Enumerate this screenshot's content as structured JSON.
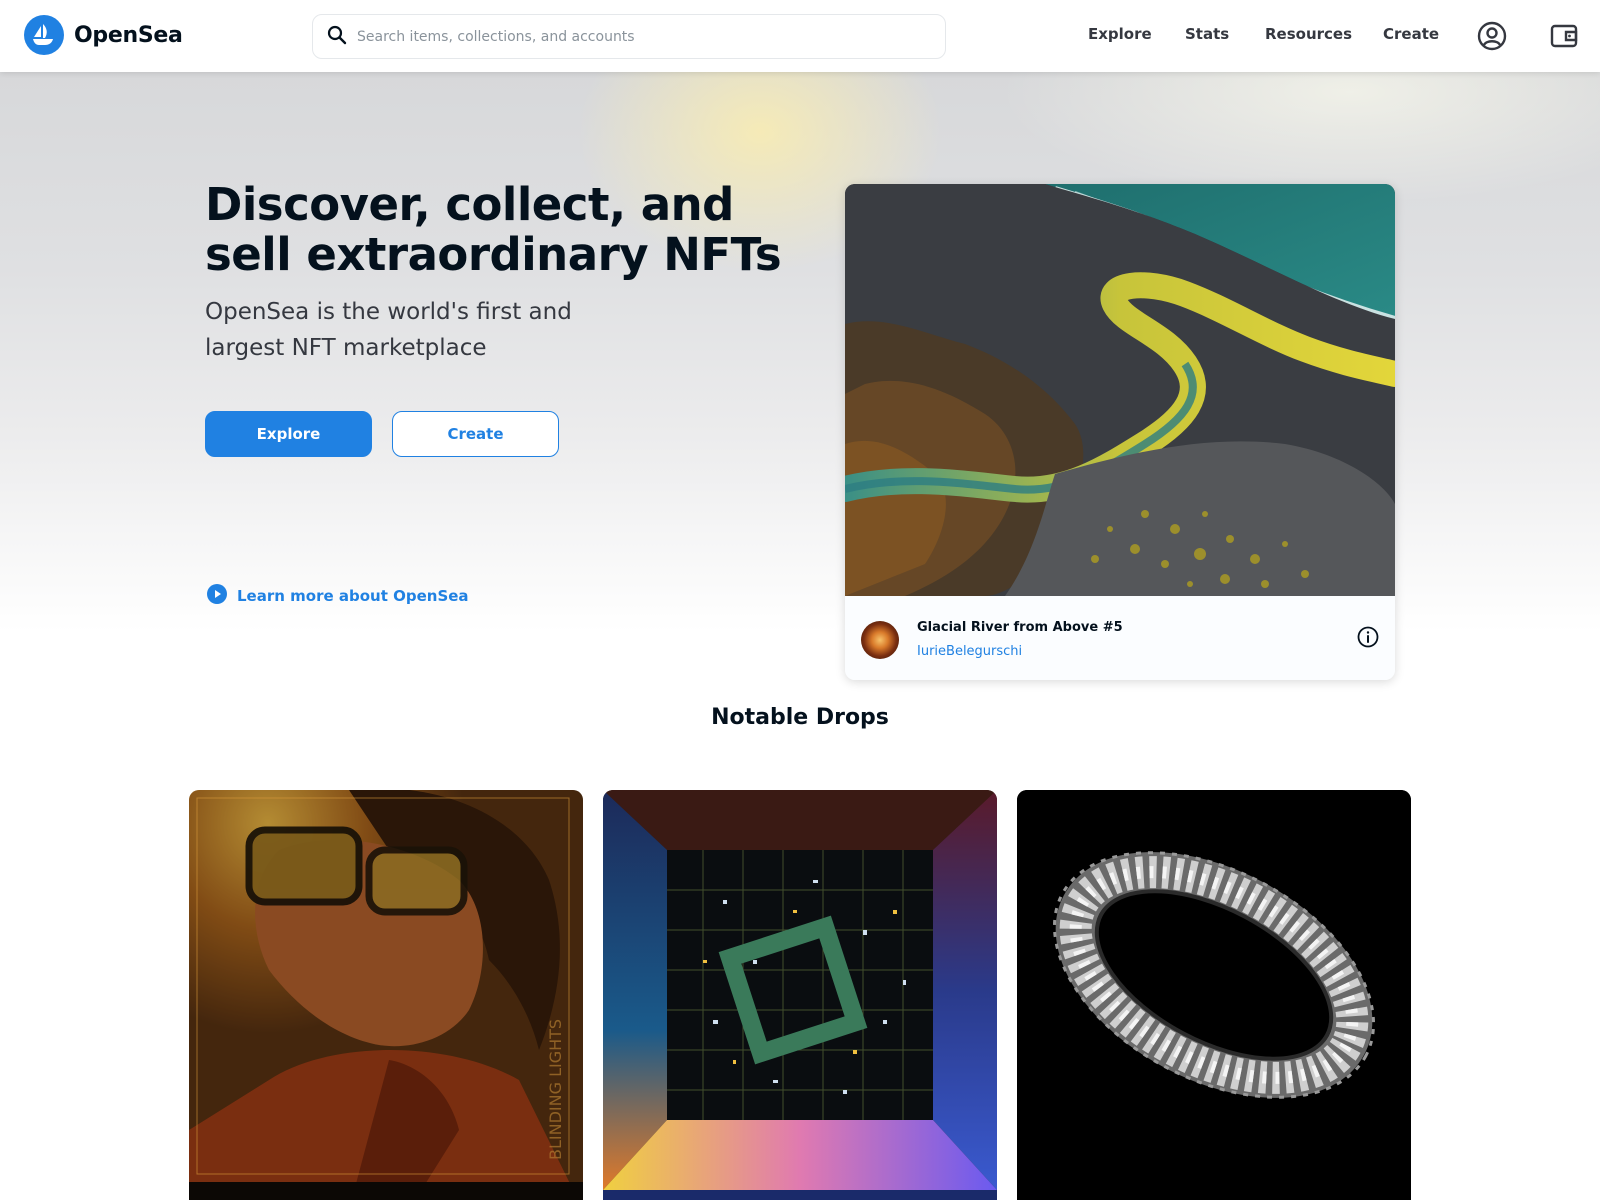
{
  "brand": {
    "name": "OpenSea"
  },
  "search": {
    "placeholder": "Search items, collections, and accounts"
  },
  "nav": {
    "links": [
      "Explore",
      "Stats",
      "Resources",
      "Create"
    ]
  },
  "hero": {
    "title": "Discover, collect, and sell extraordinary NFTs",
    "subtitle": "OpenSea is the world's first and largest NFT marketplace",
    "primary_button": "Explore",
    "secondary_button": "Create",
    "learn_more": "Learn more about OpenSea"
  },
  "featured": {
    "name": "Glacial River from Above #5",
    "creator": "IurieBelegurschi"
  },
  "notable_drops": {
    "title": "Notable Drops",
    "vertical_caption": "BLINDING LIGHTS"
  },
  "colors": {
    "accent": "#2081e2",
    "text_primary": "#04111d",
    "text_secondary": "#353840"
  },
  "icons": [
    "opensea-logo",
    "search-icon",
    "account-icon",
    "wallet-icon",
    "play-circle-icon",
    "info-icon"
  ]
}
